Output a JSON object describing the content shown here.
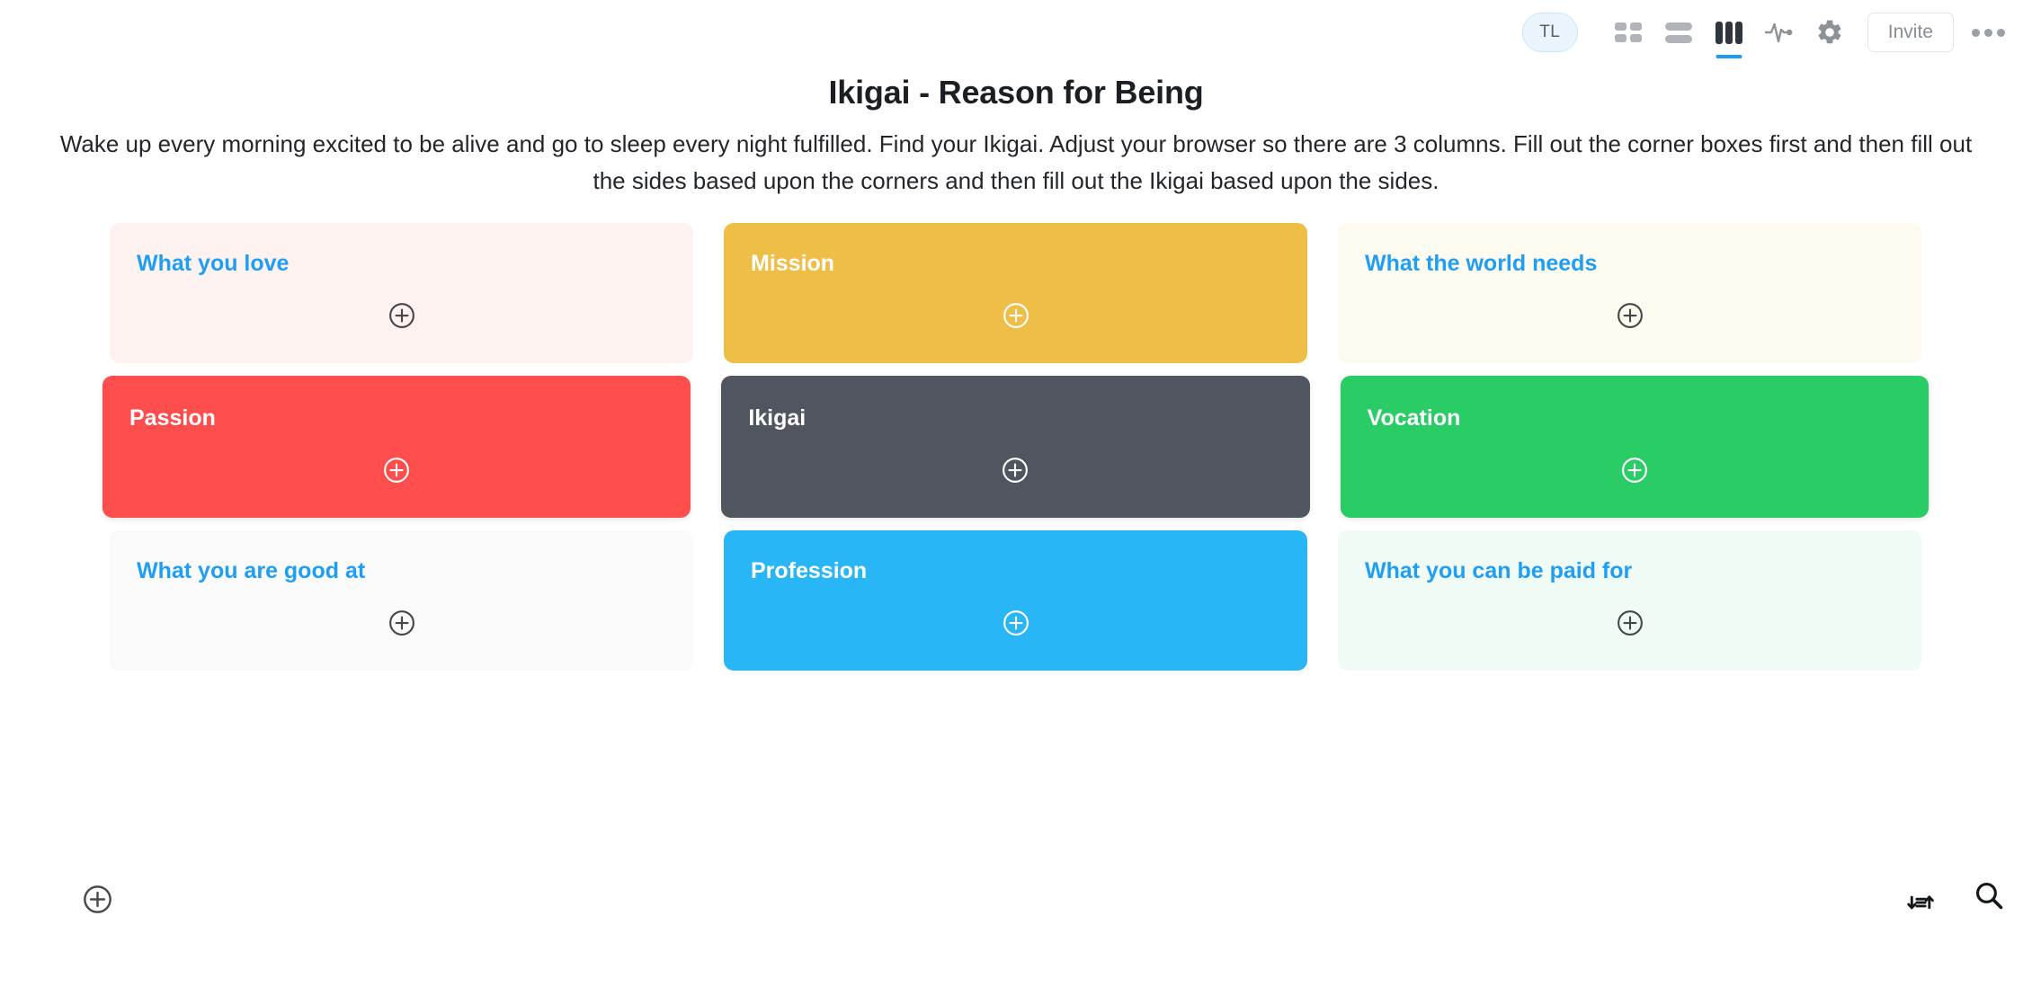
{
  "header": {
    "title": "Ikigai - Reason for Being",
    "description": "Wake up every morning excited to be alive and go to sleep every night fulfilled. Find your Ikigai. Adjust your browser so there are 3 columns. Fill out the corner boxes first and then fill out the sides based upon the corners and then fill out the Ikigai based upon the sides."
  },
  "toolbar": {
    "avatar_initials": "TL",
    "invite_label": "Invite",
    "icons": [
      {
        "name": "grid-view-icon",
        "active": false
      },
      {
        "name": "list-view-icon",
        "active": false
      },
      {
        "name": "columns-view-icon",
        "active": true
      },
      {
        "name": "activity-pulse-icon",
        "active": false
      },
      {
        "name": "settings-gear-icon",
        "active": false
      }
    ],
    "more_icon": "ellipsis-icon"
  },
  "board": {
    "add_card_icon": "plus-circle-icon",
    "rows": [
      {
        "row_name": "top-row",
        "cards": [
          {
            "title": "What you love",
            "bg": "#fdf2f0",
            "fg": "#1f9ef5",
            "accent": "light"
          },
          {
            "title": "Mission",
            "bg": "#efbe46",
            "fg": "#ffffff",
            "accent": "solid"
          },
          {
            "title": "What the world needs",
            "bg": "#fdfaf0",
            "fg": "#1f9ef5",
            "accent": "light"
          }
        ]
      },
      {
        "row_name": "middle-row",
        "cards": [
          {
            "title": "Passion",
            "bg": "#fd4d4d",
            "fg": "#ffffff",
            "accent": "solid"
          },
          {
            "title": "Ikigai",
            "bg": "#50555f",
            "fg": "#ffffff",
            "accent": "solid"
          },
          {
            "title": "Vocation",
            "bg": "#2acc66",
            "fg": "#ffffff",
            "accent": "solid"
          }
        ]
      },
      {
        "row_name": "bottom-row",
        "cards": [
          {
            "title": "What you are good at",
            "bg": "#fafafa",
            "fg": "#1f9ef5",
            "accent": "light"
          },
          {
            "title": "Profession",
            "bg": "#29b6f6",
            "fg": "#ffffff",
            "accent": "solid"
          },
          {
            "title": "What you can be paid for",
            "bg": "#f1fbf5",
            "fg": "#1f9ef5",
            "accent": "light"
          }
        ]
      }
    ]
  },
  "footer": {
    "add_list_icon": "plus-circle-icon",
    "sort_icon": "sort-icon",
    "search_icon": "search-icon"
  },
  "colors": {
    "accent_blue": "#1f9ef5",
    "active_tab_underline": "#1b9df0",
    "text_primary": "#1b1f23"
  }
}
